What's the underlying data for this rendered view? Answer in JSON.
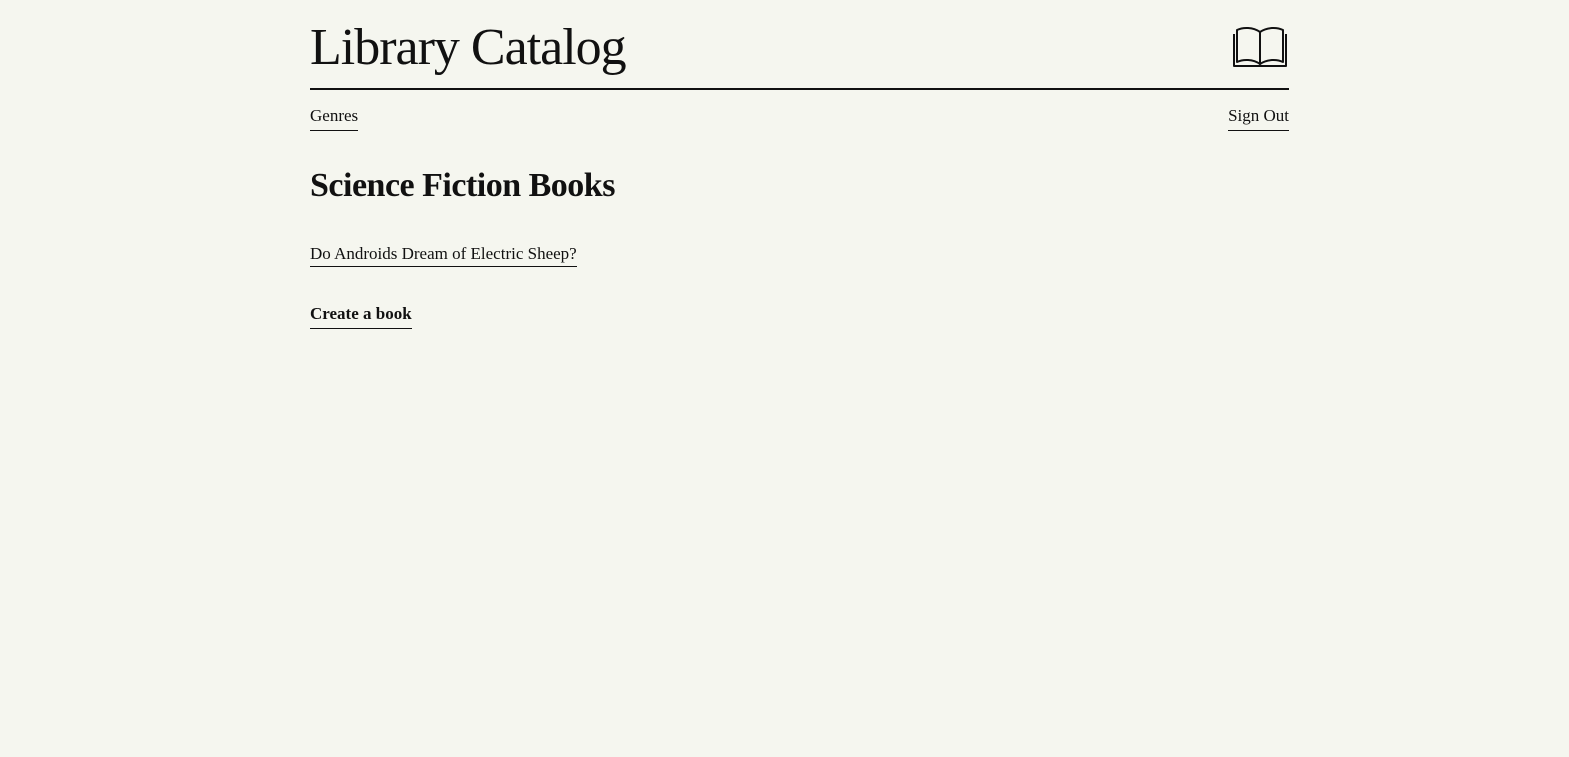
{
  "header": {
    "title": "Library Catalog",
    "logo_icon": "open-book-icon"
  },
  "nav": {
    "genres_label": "Genres",
    "sign_out_label": "Sign Out"
  },
  "main": {
    "heading": "Science Fiction Books",
    "books": [
      {
        "title": "Do Androids Dream of Electric Sheep?"
      }
    ],
    "create_label": "Create a book"
  },
  "colors": {
    "background": "#f5f6ef",
    "text": "#111111"
  }
}
